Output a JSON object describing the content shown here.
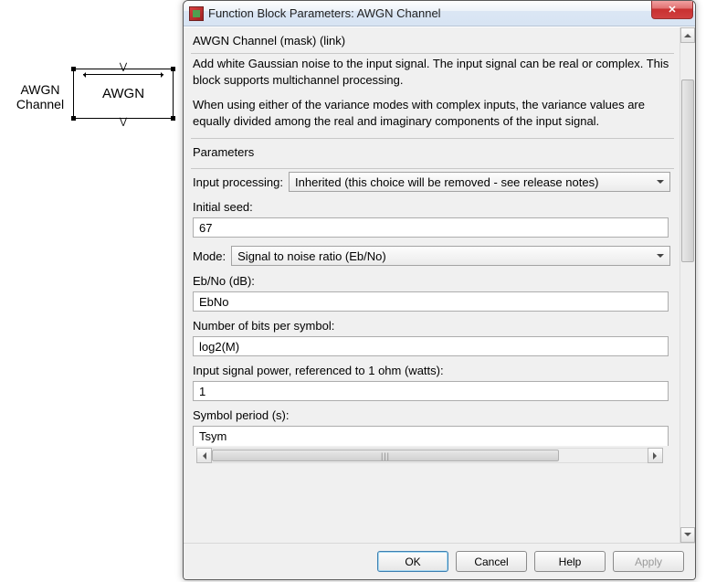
{
  "simulink": {
    "label_line1": "AWGN",
    "label_line2": "Channel",
    "block_text": "AWGN"
  },
  "dialog": {
    "title": "Function Block Parameters: AWGN Channel",
    "close_glyph": "✕",
    "mask_title": "AWGN Channel (mask) (link)",
    "description_p1": "Add white Gaussian noise to the input signal. The input signal can be real or complex. This block supports multichannel processing.",
    "description_p2": "When using either of the variance modes with complex inputs, the variance values are equally divided among the real and imaginary components of the input signal.",
    "parameters_header": "Parameters",
    "params": {
      "input_processing_label": "Input processing:",
      "input_processing_value": "Inherited (this choice will be removed - see release notes)",
      "initial_seed_label": "Initial seed:",
      "initial_seed_value": "67",
      "mode_label": "Mode:",
      "mode_value": "Signal to noise ratio  (Eb/No)",
      "ebno_label": "Eb/No (dB):",
      "ebno_value": "EbNo",
      "bits_per_symbol_label": "Number of bits per symbol:",
      "bits_per_symbol_value": "log2(M)",
      "input_power_label": "Input signal power, referenced to 1 ohm (watts):",
      "input_power_value": "1",
      "symbol_period_label": "Symbol period (s):",
      "symbol_period_value": "Tsym"
    },
    "buttons": {
      "ok": "OK",
      "cancel": "Cancel",
      "help": "Help",
      "apply": "Apply"
    },
    "hscroll_grip": "|||"
  }
}
